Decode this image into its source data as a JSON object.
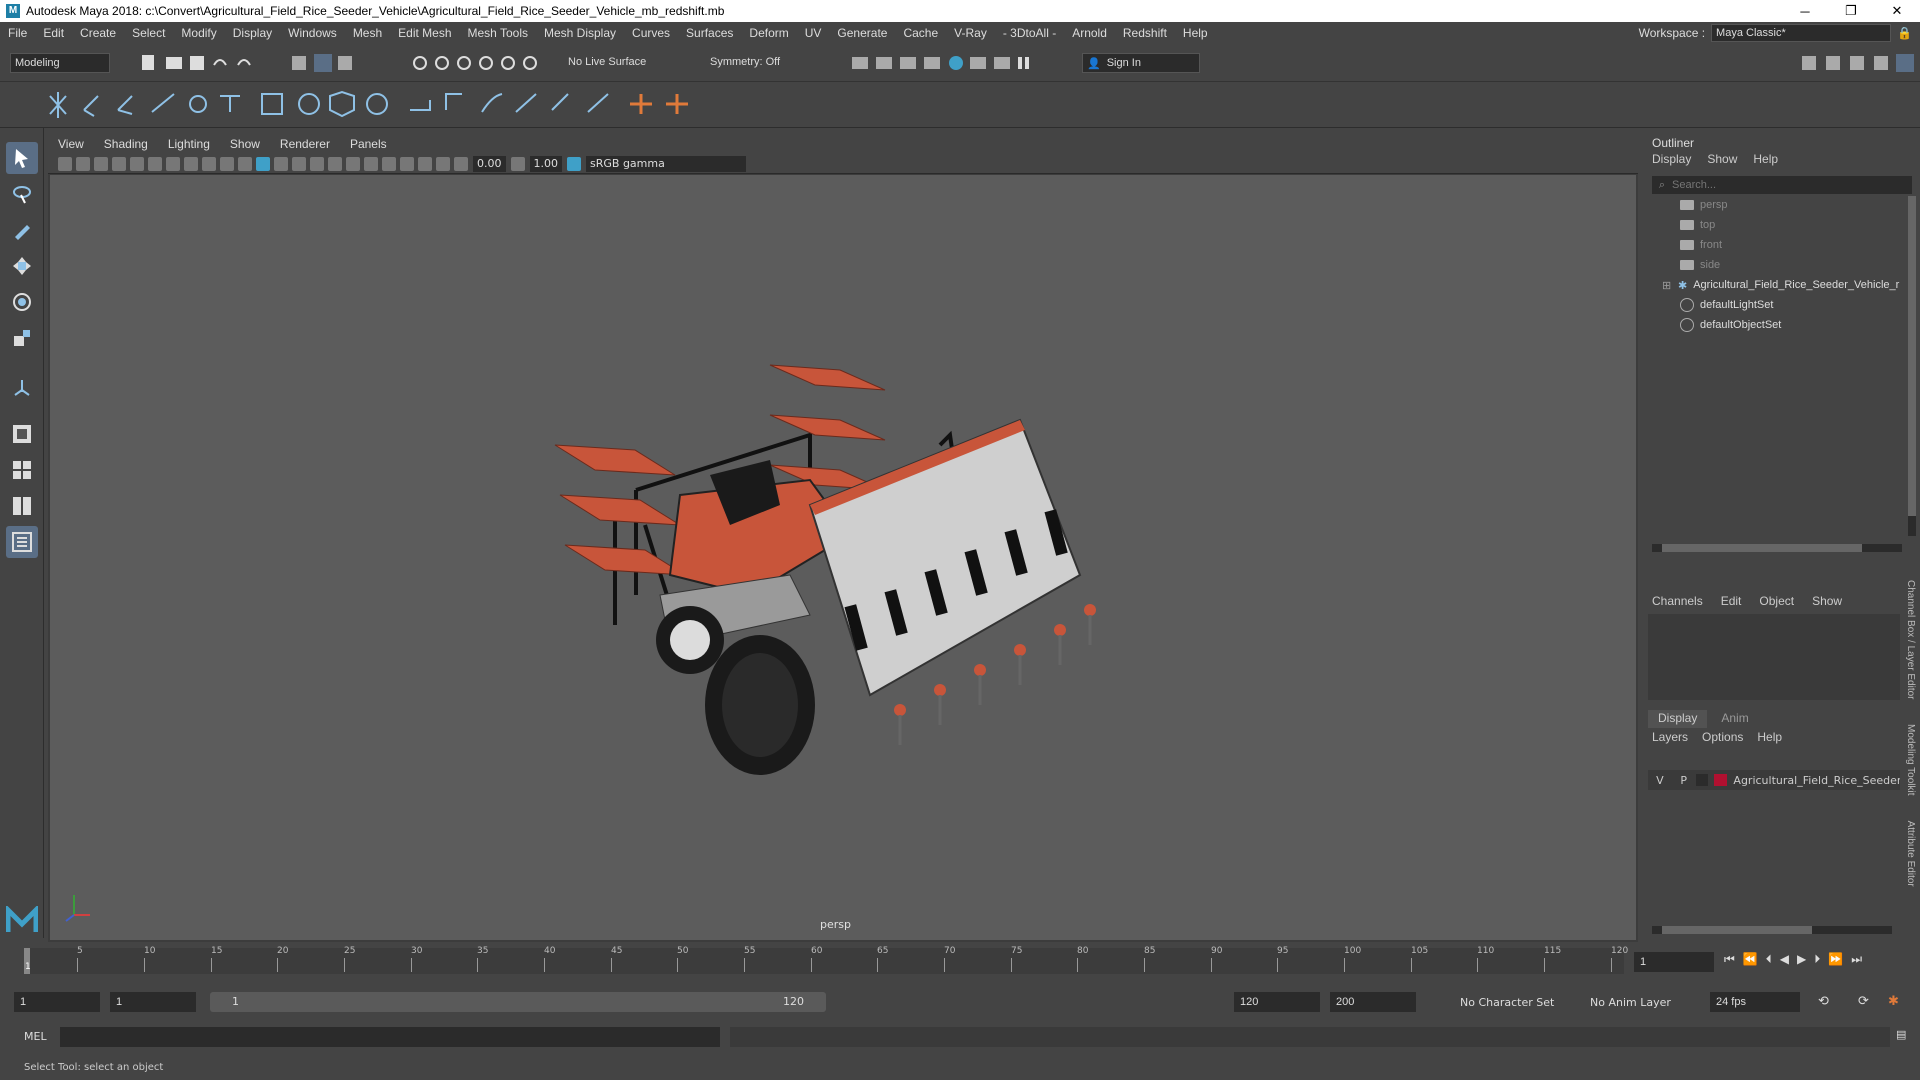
{
  "window": {
    "title": "Autodesk Maya 2018: c:\\Convert\\Agricultural_Field_Rice_Seeder_Vehicle\\Agricultural_Field_Rice_Seeder_Vehicle_mb_redshift.mb",
    "controls": [
      "─",
      "❐",
      "✕"
    ]
  },
  "menubar": {
    "items": [
      "File",
      "Edit",
      "Create",
      "Select",
      "Modify",
      "Display",
      "Windows",
      "Mesh",
      "Edit Mesh",
      "Mesh Tools",
      "Mesh Display",
      "Curves",
      "Surfaces",
      "Deform",
      "UV",
      "Generate",
      "Cache",
      "V-Ray",
      "- 3DtoAll -",
      "Arnold",
      "Redshift",
      "Help"
    ],
    "workspace_label": "Workspace :",
    "workspace_value": "Maya Classic*"
  },
  "statusline": {
    "mode": "Modeling",
    "live_surface": "No Live Surface",
    "symmetry": "Symmetry: Off",
    "sign_in": "Sign In"
  },
  "viewport": {
    "menu": [
      "View",
      "Shading",
      "Lighting",
      "Show",
      "Renderer",
      "Panels"
    ],
    "exposure": "0.00",
    "gamma": "1.00",
    "color_space": "sRGB gamma",
    "camera_label": "persp"
  },
  "outliner": {
    "title": "Outliner",
    "menu": [
      "Display",
      "Show",
      "Help"
    ],
    "search_placeholder": "Search...",
    "items": [
      {
        "label": "persp",
        "dim": true
      },
      {
        "label": "top",
        "dim": true
      },
      {
        "label": "front",
        "dim": true
      },
      {
        "label": "side",
        "dim": true
      },
      {
        "label": "Agricultural_Field_Rice_Seeder_Vehicle_r",
        "dim": false
      },
      {
        "label": "defaultLightSet",
        "dim": false
      },
      {
        "label": "defaultObjectSet",
        "dim": false
      }
    ]
  },
  "channelbox": {
    "menu": [
      "Channels",
      "Edit",
      "Object",
      "Show"
    ],
    "tabs": [
      "Display",
      "Anim"
    ],
    "layer_menu": [
      "Layers",
      "Options",
      "Help"
    ],
    "layer": {
      "v": "V",
      "p": "P",
      "name": "Agricultural_Field_Rice_Seeder"
    },
    "side_tabs": [
      "Channel Box / Layer Editor",
      "Modeling Toolkit",
      "Attribute Editor"
    ]
  },
  "timeline": {
    "ticks": [
      "5",
      "10",
      "15",
      "20",
      "25",
      "30",
      "35",
      "40",
      "45",
      "50",
      "55",
      "60",
      "65",
      "70",
      "75",
      "80",
      "85",
      "90",
      "95",
      "100",
      "105",
      "110",
      "115",
      "120"
    ],
    "current_frame_marker": "1",
    "current_frame": "1"
  },
  "rangebar": {
    "start": "1",
    "playback_start": "1",
    "slider_start": "1",
    "slider_end": "120",
    "playback_end": "120",
    "end": "200",
    "character_set": "No Character Set",
    "anim_layer": "No Anim Layer",
    "fps": "24 fps"
  },
  "cmdline": {
    "label": "MEL"
  },
  "helpline": {
    "text": "Select Tool: select an object"
  },
  "colors": {
    "accent": "#5a6e86",
    "tractor_orange": "#c8553a",
    "layer_color": "#b01030"
  }
}
